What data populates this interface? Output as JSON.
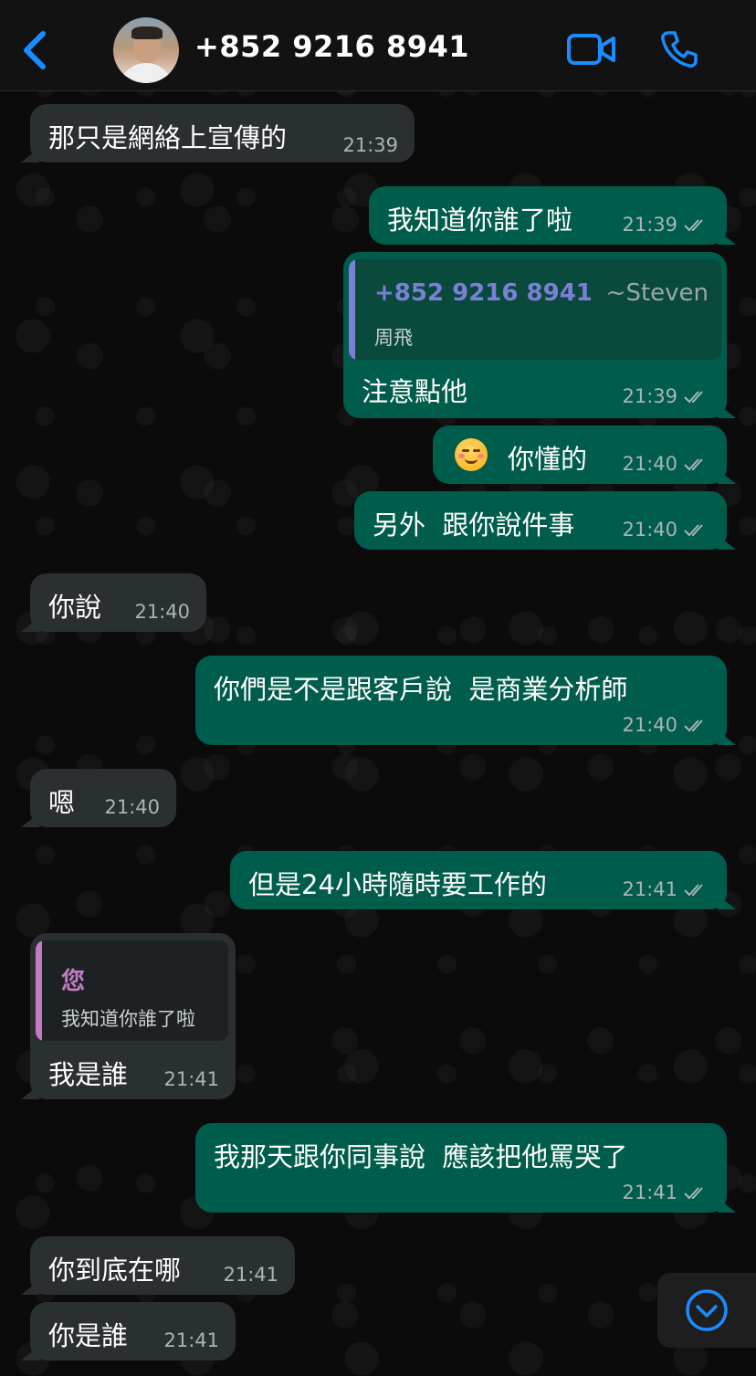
{
  "header": {
    "contact_name": "+852 9216 8941",
    "back_icon": "chevron-left-icon",
    "video_icon": "video-camera-icon",
    "call_icon": "phone-icon",
    "accent_color": "#1a8cff"
  },
  "messages": [
    {
      "dir": "in",
      "text": "那只是網絡上宣傳的",
      "time": "21:39"
    },
    {
      "dir": "out",
      "text": "我知道你誰了啦",
      "time": "21:39"
    },
    {
      "dir": "out",
      "text": "注意點他",
      "time": "21:39",
      "quote": {
        "author": "+852 9216 8941",
        "extra": "~Steven",
        "text": "周飛"
      }
    },
    {
      "dir": "out",
      "text": "你懂的",
      "time": "21:40",
      "emoji": "woozy-face-emoji"
    },
    {
      "dir": "out",
      "text": "另外  跟你說件事",
      "time": "21:40"
    },
    {
      "dir": "in",
      "text": "你說",
      "time": "21:40"
    },
    {
      "dir": "out",
      "text": "你們是不是跟客戶說  是商業分析師",
      "time": "21:40"
    },
    {
      "dir": "in",
      "text": "嗯",
      "time": "21:40"
    },
    {
      "dir": "out",
      "text": "但是24小時隨時要工作的",
      "time": "21:41"
    },
    {
      "dir": "in",
      "text": "我是誰",
      "time": "21:41",
      "quote": {
        "author": "您",
        "text": "我知道你誰了啦"
      }
    },
    {
      "dir": "out",
      "text": "我那天跟你同事說  應該把他罵哭了",
      "time": "21:41"
    },
    {
      "dir": "in",
      "text": "你到底在哪",
      "time": "21:41"
    },
    {
      "dir": "in",
      "text": "你是誰",
      "time": "21:41"
    }
  ],
  "scroll_button": {
    "icon": "chevron-down-circle-icon"
  },
  "colors": {
    "outgoing_bubble": "#005c4b",
    "incoming_bubble": "#2a2f32",
    "quote_author_out": "#7b7fd6",
    "quote_author_in": "#c37bc2"
  }
}
